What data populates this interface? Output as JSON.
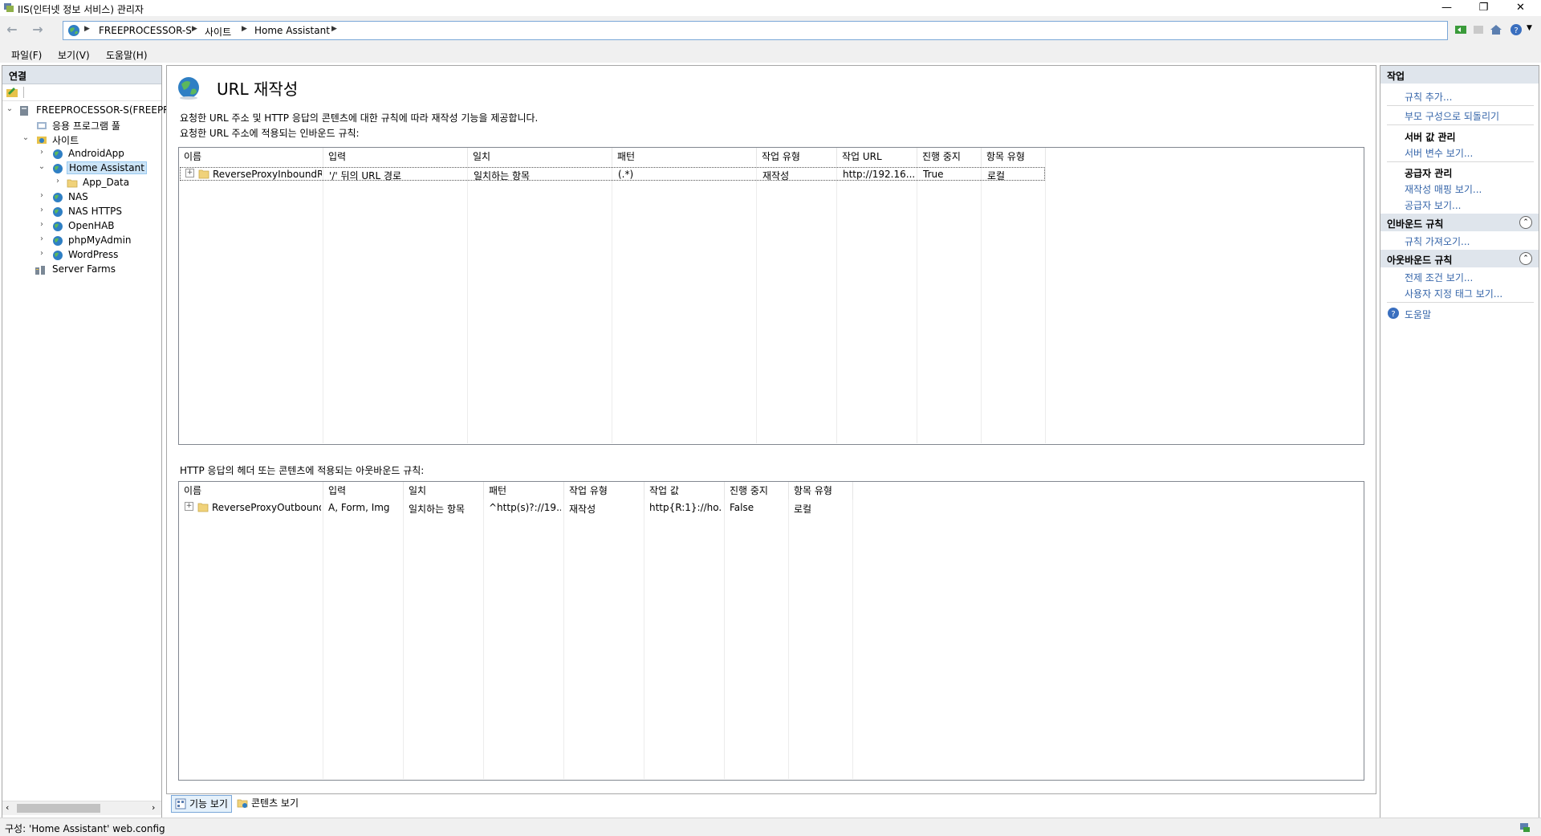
{
  "window": {
    "title": "IIS(인터넷 정보 서비스) 관리자",
    "minimize_glyph": "—",
    "restore_glyph": "❐",
    "close_glyph": "✕"
  },
  "address": {
    "crumbs": [
      "FREEPROCESSOR-S",
      "사이트",
      "Home Assistant"
    ],
    "back_glyph": "←",
    "forward_glyph": "→"
  },
  "menu": {
    "file": "파일(F)",
    "view": "보기(V)",
    "help": "도움말(H)"
  },
  "connections": {
    "header": "연결",
    "tree": [
      {
        "label": "FREEPROCESSOR-S(FREEPROC",
        "icon": "server-icon",
        "level": 0,
        "expanded": true
      },
      {
        "label": "응용 프로그램 풀",
        "icon": "app-pool-icon",
        "level": 1
      },
      {
        "label": "사이트",
        "icon": "sites-folder-icon",
        "level": 1,
        "expanded": true
      },
      {
        "label": "AndroidApp",
        "icon": "globe-icon",
        "level": 2
      },
      {
        "label": "Home Assistant",
        "icon": "globe-icon",
        "level": 2,
        "expanded": true,
        "selected": true
      },
      {
        "label": "App_Data",
        "icon": "folder-icon",
        "level": 3
      },
      {
        "label": "NAS",
        "icon": "globe-icon",
        "level": 2
      },
      {
        "label": "NAS HTTPS",
        "icon": "globe-icon",
        "level": 2
      },
      {
        "label": "OpenHAB",
        "icon": "globe-icon",
        "level": 2
      },
      {
        "label": "phpMyAdmin",
        "icon": "globe-icon",
        "level": 2
      },
      {
        "label": "WordPress",
        "icon": "globe-icon",
        "level": 2
      },
      {
        "label": "Server Farms",
        "icon": "server-farms-icon",
        "level": 1
      }
    ]
  },
  "main": {
    "title": "URL 재작성",
    "description": "요청한 URL 주소 및 HTTP 응답의 콘텐츠에 대한 규칙에 따라 재작성 기능을 제공합니다.",
    "inbound_caption": "요청한 URL 주소에 적용되는 인바운드 규칙:",
    "inbound_columns": [
      "이름",
      "입력",
      "일치",
      "패턴",
      "작업 유형",
      "작업 URL",
      "진행 중지",
      "항목 유형"
    ],
    "inbound_rows": [
      [
        "ReverseProxyInboundR...",
        "'/' 뒤의 URL 경로",
        "일치하는 항목",
        "(.*)",
        "재작성",
        "http://192.16...",
        "True",
        "로컬"
      ]
    ],
    "outbound_caption": "HTTP 응답의 헤더 또는 콘텐츠에 적용되는 아웃바운드 규칙:",
    "outbound_columns": [
      "이름",
      "입력",
      "일치",
      "패턴",
      "작업 유형",
      "작업 값",
      "진행 중지",
      "항목 유형"
    ],
    "outbound_rows": [
      [
        "ReverseProxyOutbound...",
        "A, Form, Img",
        "일치하는 항목",
        "^http(s)?://19...",
        "재작성",
        "http{R:1}://ho...",
        "False",
        "로컬"
      ]
    ]
  },
  "tabs": {
    "features": "기능 보기",
    "content": "콘텐츠 보기"
  },
  "actions": {
    "header": "작업",
    "add_rule": "규칙 추가...",
    "revert_parent": "부모 구성으로 되돌리기",
    "server_vars_title": "서버 값 관리",
    "view_server_vars": "서버 변수 보기...",
    "providers_title": "공급자 관리",
    "view_rewrite_maps": "재작성 매핑 보기...",
    "view_providers": "공급자 보기...",
    "inbound_title": "인바운드 규칙",
    "import_rules": "규칙 가져오기...",
    "outbound_title": "아웃바운드 규칙",
    "view_preconditions": "전제 조건 보기...",
    "view_custom_tags": "사용자 지정 태그 보기...",
    "help": "도움말"
  },
  "status": {
    "text": "구성: 'Home Assistant' web.config"
  },
  "colors": {
    "accent": "#3565a9",
    "pane_header": "#dfe5ec",
    "selection": "#cce4f7"
  }
}
